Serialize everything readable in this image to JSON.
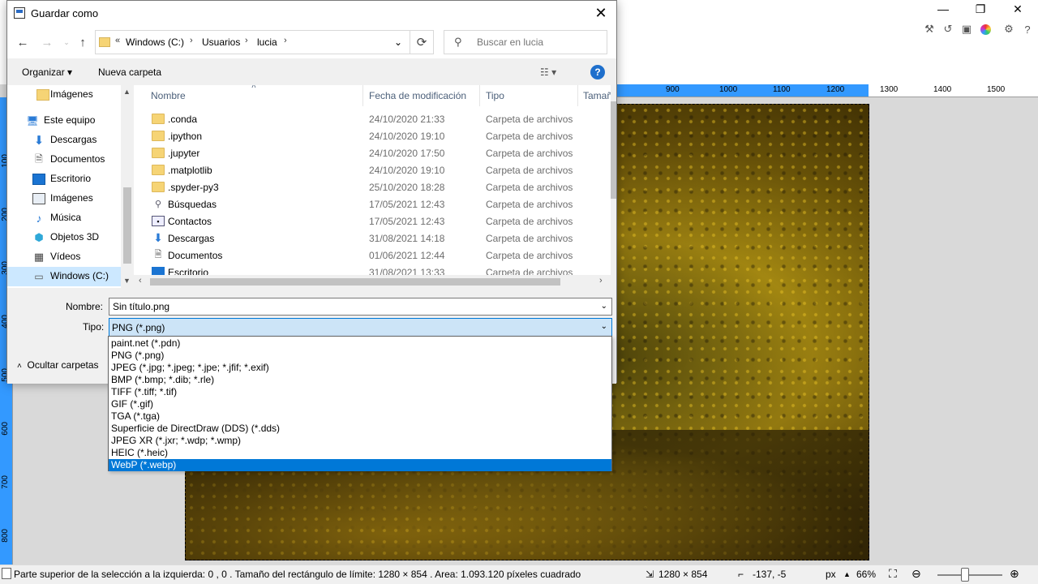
{
  "dialog": {
    "title": "Guardar como",
    "address": {
      "prefix": "«",
      "crumbs": [
        "Windows (C:)",
        "Usuarios",
        "lucia"
      ]
    },
    "search_placeholder": "Buscar en lucia",
    "commands": {
      "organize": "Organizar",
      "organize_arrow": "▾",
      "new_folder": "Nueva carpeta",
      "help": "?"
    },
    "nav_pane": [
      {
        "label": "Imágenes",
        "icon": "folder-icon"
      },
      {
        "label": "Este equipo",
        "icon": "computer-icon"
      },
      {
        "label": "Descargas",
        "icon": "download-icon"
      },
      {
        "label": "Documentos",
        "icon": "document-icon"
      },
      {
        "label": "Escritorio",
        "icon": "desktop-icon"
      },
      {
        "label": "Imágenes",
        "icon": "pictures-icon"
      },
      {
        "label": "Música",
        "icon": "music-icon"
      },
      {
        "label": "Objetos 3D",
        "icon": "3d-objects-icon"
      },
      {
        "label": "Vídeos",
        "icon": "videos-icon"
      },
      {
        "label": "Windows (C:)",
        "icon": "drive-icon"
      }
    ],
    "columns": {
      "name": "Nombre",
      "date": "Fecha de modificación",
      "type": "Tipo",
      "size": "Tamaño"
    },
    "files": [
      {
        "name": ".conda",
        "date": "24/10/2020 21:33",
        "type": "Carpeta de archivos",
        "icon": "folder-icon"
      },
      {
        "name": ".ipython",
        "date": "24/10/2020 19:10",
        "type": "Carpeta de archivos",
        "icon": "folder-icon"
      },
      {
        "name": ".jupyter",
        "date": "24/10/2020 17:50",
        "type": "Carpeta de archivos",
        "icon": "folder-icon"
      },
      {
        "name": ".matplotlib",
        "date": "24/10/2020 19:10",
        "type": "Carpeta de archivos",
        "icon": "folder-icon"
      },
      {
        "name": ".spyder-py3",
        "date": "25/10/2020 18:28",
        "type": "Carpeta de archivos",
        "icon": "folder-icon"
      },
      {
        "name": "Búsquedas",
        "date": "17/05/2021 12:43",
        "type": "Carpeta de archivos",
        "icon": "search-folder-icon"
      },
      {
        "name": "Contactos",
        "date": "17/05/2021 12:43",
        "type": "Carpeta de archivos",
        "icon": "contacts-icon"
      },
      {
        "name": "Descargas",
        "date": "31/08/2021 14:18",
        "type": "Carpeta de archivos",
        "icon": "download-icon"
      },
      {
        "name": "Documentos",
        "date": "01/06/2021 12:44",
        "type": "Carpeta de archivos",
        "icon": "document-icon"
      },
      {
        "name": "Escritorio",
        "date": "31/08/2021 13:33",
        "type": "Carpeta de archivos",
        "icon": "desktop-icon"
      }
    ],
    "form": {
      "name_label": "Nombre:",
      "name_value": "Sin título.png",
      "type_label": "Tipo:",
      "type_value": "PNG (*.png)",
      "hide_folders": "Ocultar carpetas"
    },
    "type_options": [
      "paint.net (*.pdn)",
      "PNG (*.png)",
      "JPEG (*.jpg; *.jpeg; *.jpe; *.jfif; *.exif)",
      "BMP (*.bmp; *.dib; *.rle)",
      "TIFF (*.tiff; *.tif)",
      "GIF (*.gif)",
      "TGA (*.tga)",
      "Superficie de DirectDraw (DDS) (*.dds)",
      "JPEG XR (*.jxr; *.wdp; *.wmp)",
      "HEIC (*.heic)",
      "WebP (*.webp)"
    ],
    "highlighted_option": "WebP (*.webp)"
  },
  "ruler": {
    "top": [
      "900",
      "1000",
      "1100",
      "1200",
      "1300",
      "1400",
      "1500"
    ],
    "left": [
      "100",
      "200",
      "300",
      "400",
      "500",
      "600",
      "700",
      "800"
    ]
  },
  "statusbar": {
    "selection_info": "Parte superior de la selección a la izquierda: 0 , 0 . Tamaño del rectángulo de límite: 1280  × 854 . Area: 1.093.120 píxeles cuadrado",
    "image_size": "1280 × 854",
    "cursor_pos": "-137, -5",
    "unit": "px",
    "zoom": "66%"
  },
  "colors": {
    "accent": "#0078d7",
    "ruler_selection": "#3399ff",
    "selected_nav": "#cce8ff",
    "folder": "#f6d475"
  }
}
